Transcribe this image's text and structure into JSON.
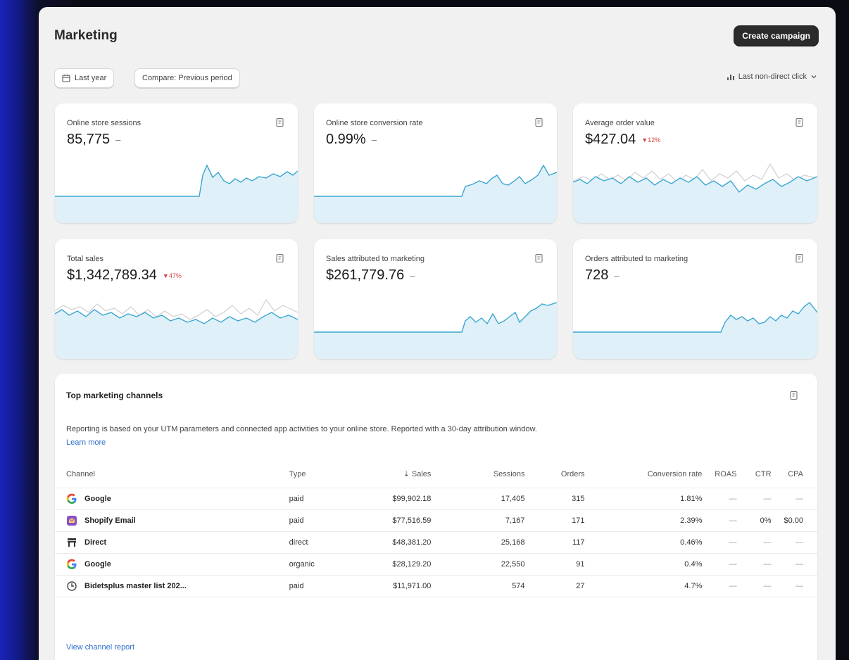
{
  "header": {
    "title": "Marketing",
    "create_button": "Create campaign"
  },
  "filters": {
    "date_range": "Last year",
    "compare": "Compare: Previous period",
    "attribution": "Last non-direct click"
  },
  "metrics": [
    {
      "label": "Online store sessions",
      "value": "85,775",
      "change": "–",
      "icon": "chart-report-icon"
    },
    {
      "label": "Online store conversion rate",
      "value": "0.99%",
      "change": "–",
      "icon": "chart-report-icon"
    },
    {
      "label": "Average order value",
      "value": "$427.04",
      "change": "▼12%",
      "icon": "chart-report-icon"
    },
    {
      "label": "Total sales",
      "value": "$1,342,789.34",
      "change": "▼47%",
      "icon": "chart-report-icon"
    },
    {
      "label": "Sales attributed to marketing",
      "value": "$261,779.76",
      "change": "–",
      "icon": "chart-report-icon"
    },
    {
      "label": "Orders attributed to marketing",
      "value": "728",
      "change": "–",
      "icon": "chart-report-icon"
    }
  ],
  "channels": {
    "title": "Top marketing channels",
    "description": "Reporting is based on your UTM parameters and connected app activities to your online store. Reported with a 30-day attribution window.",
    "learn_more": "Learn more",
    "columns": {
      "channel": "Channel",
      "type": "Type",
      "sales": "Sales",
      "sessions": "Sessions",
      "orders": "Orders",
      "conversion": "Conversion rate",
      "roas": "ROAS",
      "ctr": "CTR",
      "cpa": "CPA"
    },
    "rows": [
      {
        "name": "Google",
        "icon": "google-icon",
        "type": "paid",
        "sales": "$99,902.18",
        "sessions": "17,405",
        "orders": "315",
        "conversion": "1.81%",
        "roas": "—",
        "ctr": "—",
        "cpa": "—"
      },
      {
        "name": "Shopify Email",
        "icon": "shopify-email-icon",
        "type": "paid",
        "sales": "$77,516.59",
        "sessions": "7,167",
        "orders": "171",
        "conversion": "2.39%",
        "roas": "—",
        "ctr": "0%",
        "cpa": "$0.00"
      },
      {
        "name": "Direct",
        "icon": "store-icon",
        "type": "direct",
        "sales": "$48,381.20",
        "sessions": "25,168",
        "orders": "117",
        "conversion": "0.46%",
        "roas": "—",
        "ctr": "—",
        "cpa": "—"
      },
      {
        "name": "Google",
        "icon": "google-icon",
        "type": "organic",
        "sales": "$28,129.20",
        "sessions": "22,550",
        "orders": "91",
        "conversion": "0.4%",
        "roas": "—",
        "ctr": "—",
        "cpa": "—"
      },
      {
        "name": "Bidetsplus master list 202...",
        "icon": "email-list-icon",
        "type": "paid",
        "sales": "$11,971.00",
        "sessions": "574",
        "orders": "27",
        "conversion": "4.7%",
        "roas": "—",
        "ctr": "—",
        "cpa": "—"
      }
    ],
    "view_report": "View channel report"
  }
}
